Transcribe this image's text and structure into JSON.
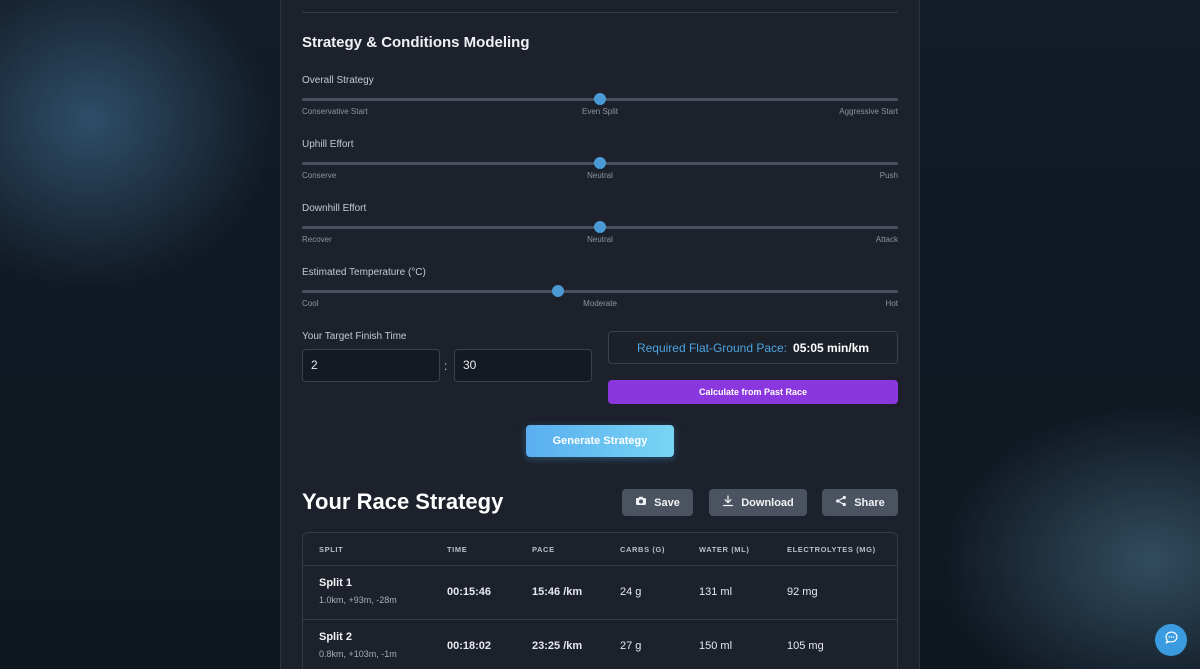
{
  "strategy": {
    "title": "Strategy & Conditions Modeling",
    "sliders": [
      {
        "label": "Overall Strategy",
        "value": 0.5,
        "left": "Conservative Start",
        "mid": "Even Split",
        "right": "Aggressive Start"
      },
      {
        "label": "Uphill Effort",
        "value": 0.5,
        "left": "Conserve",
        "mid": "Neutral",
        "right": "Push"
      },
      {
        "label": "Downhill Effort",
        "value": 0.5,
        "left": "Recover",
        "mid": "Neutral",
        "right": "Attack"
      },
      {
        "label": "Estimated Temperature (°C)",
        "value": 0.43,
        "left": "Cool",
        "mid": "Moderate",
        "right": "Hot"
      }
    ]
  },
  "finish": {
    "label": "Your Target Finish Time",
    "hours": "2",
    "separator": ":",
    "minutes": "30"
  },
  "pace": {
    "label": "Required Flat-Ground Pace:",
    "value": "05:05 min/km"
  },
  "buttons": {
    "calculate": "Calculate from Past Race",
    "generate": "Generate Strategy",
    "save": "Save",
    "download": "Download",
    "share": "Share"
  },
  "result": {
    "title": "Your Race Strategy",
    "columns": [
      "SPLIT",
      "TIME",
      "PACE",
      "CARBS (G)",
      "WATER (ML)",
      "ELECTROLYTES (MG)"
    ],
    "rows": [
      {
        "name": "Split 1",
        "detail": "1.0km, +93m, -28m",
        "time": "00:15:46",
        "pace": "15:46 /km",
        "carbs": "24 g",
        "water": "131 ml",
        "electrolytes": "92 mg"
      },
      {
        "name": "Split 2",
        "detail": "0.8km, +103m, -1m",
        "time": "00:18:02",
        "pace": "23:25 /km",
        "carbs": "27 g",
        "water": "150 ml",
        "electrolytes": "105 mg"
      }
    ]
  },
  "colors": {
    "accent": "#4a9ad6",
    "purple": "#8a37e0",
    "panel": "#1c212b"
  },
  "icons": {
    "save": "camera-icon",
    "download": "download-icon",
    "share": "share-icon",
    "chat": "chat-icon"
  }
}
